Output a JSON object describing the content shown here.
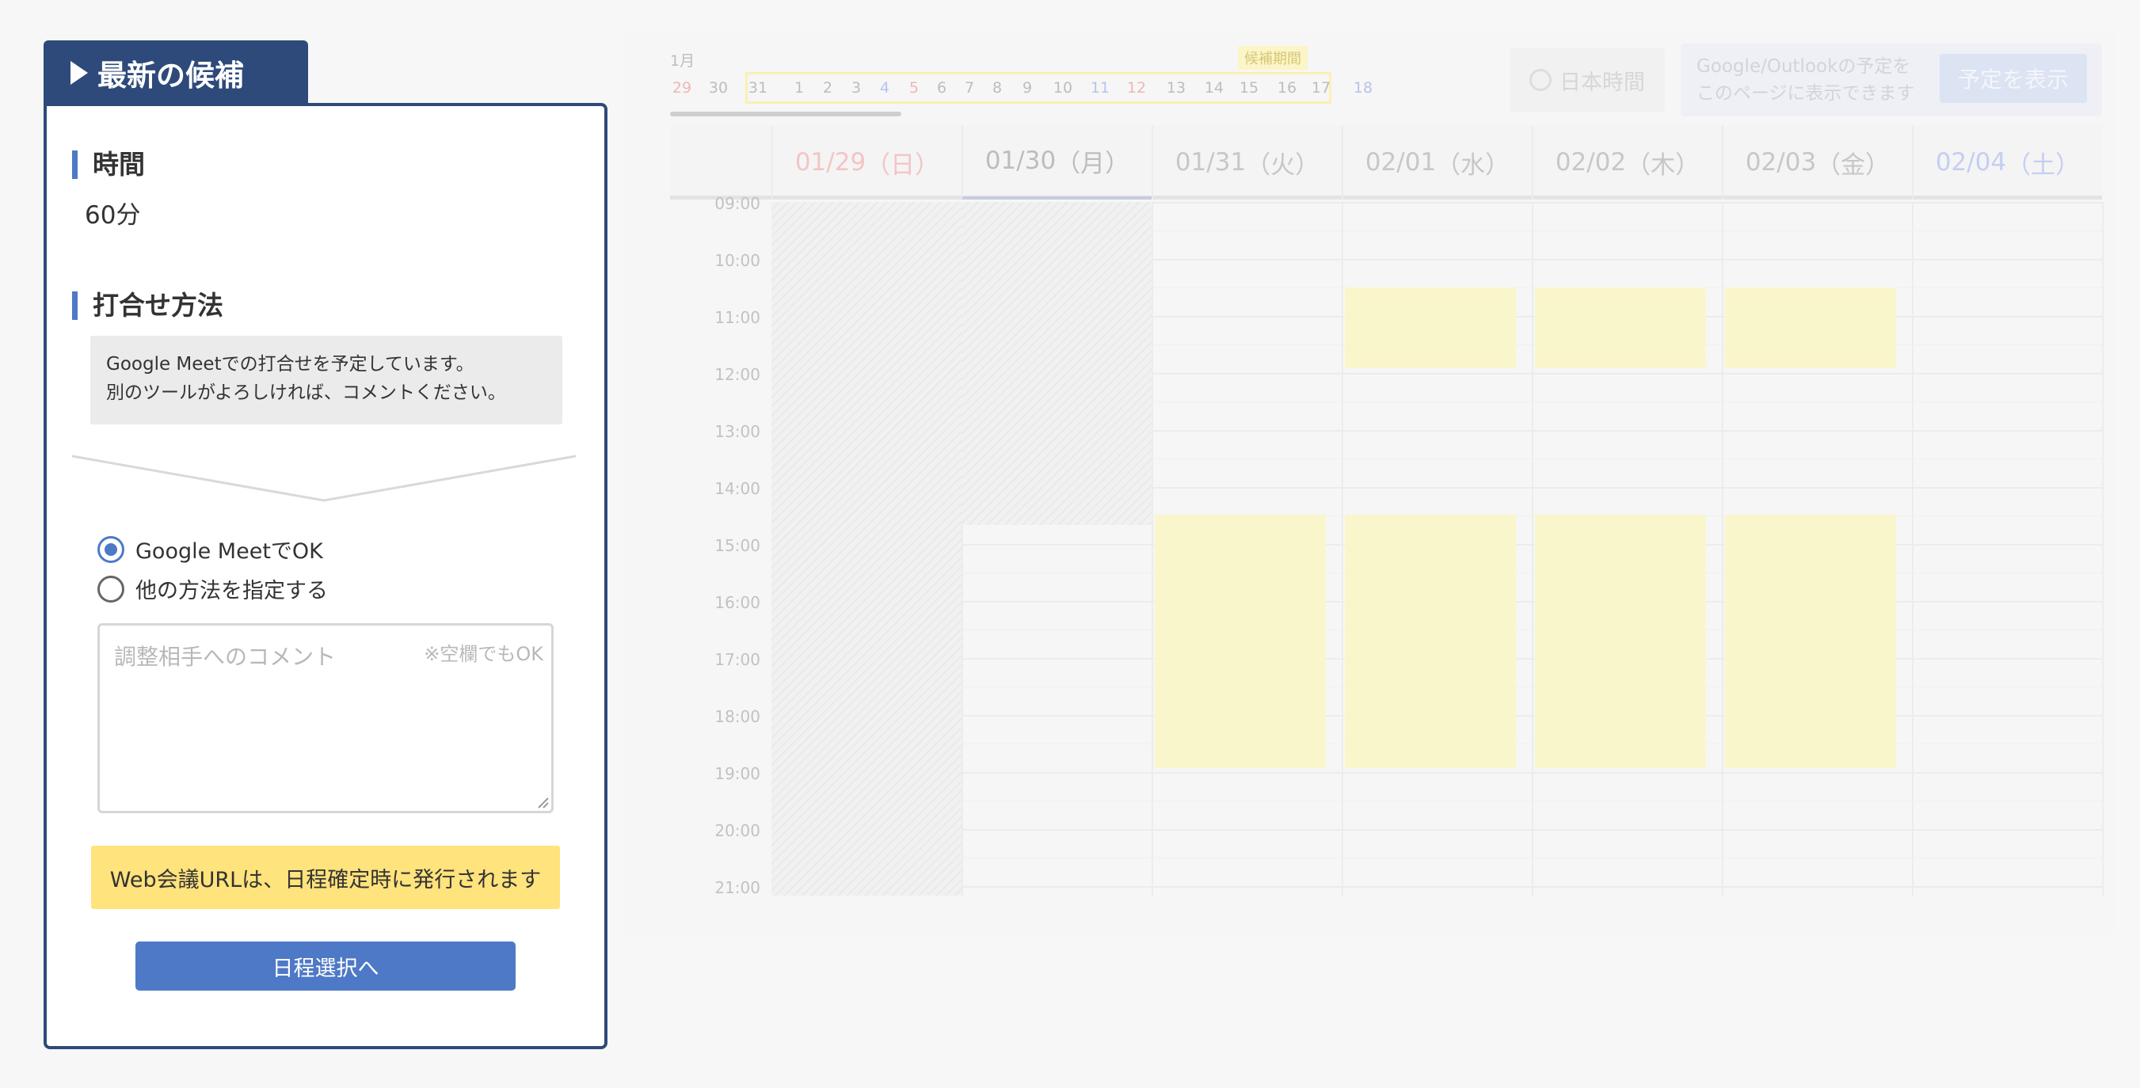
{
  "panel": {
    "tab_title": "最新の候補",
    "time_heading": "時間",
    "duration": "60分",
    "method_heading": "打合せ方法",
    "method_line1": "Google Meetでの打合せを予定しています。",
    "method_line2": "別のツールがよろしければ、コメントください。",
    "radio_ok_label": "Google MeetでOK",
    "radio_other_label": "他の方法を指定する",
    "selected_option": "Google MeetでOK",
    "comment_placeholder": "調整相手へのコメント",
    "comment_optional_note": "※空欄でもOK",
    "notice": "Web会議URLは、日程確定時に発行されます",
    "next_button": "日程選択へ"
  },
  "calendar": {
    "month_label": "1月",
    "days": [
      "29",
      "30",
      "31",
      "1",
      "2",
      "3",
      "4",
      "5",
      "6",
      "7",
      "8",
      "9",
      "10",
      "11",
      "12",
      "13",
      "14",
      "15",
      "16",
      "17",
      "18"
    ],
    "candidate_period_label": "候補期間",
    "timezone_button": "日本時間",
    "external_text_line1": "Google/Outlookの予定を",
    "external_text_line2": "このページに表示できます",
    "show_events_button": "予定を表示",
    "columns": [
      {
        "date": "01/29",
        "weekday": "（日）"
      },
      {
        "date": "01/30",
        "weekday": "（月）"
      },
      {
        "date": "01/31",
        "weekday": "（火）"
      },
      {
        "date": "02/01",
        "weekday": "（水）"
      },
      {
        "date": "02/02",
        "weekday": "（木）"
      },
      {
        "date": "02/03",
        "weekday": "（金）"
      },
      {
        "date": "02/04",
        "weekday": "（土）"
      }
    ],
    "hours": [
      "09:00",
      "10:00",
      "11:00",
      "12:00",
      "13:00",
      "14:00",
      "15:00",
      "16:00",
      "17:00",
      "18:00",
      "19:00",
      "20:00",
      "21:00"
    ],
    "colors": {
      "accent": "#4e79c6",
      "navy": "#2d4a7a",
      "notice": "#ffe37c",
      "candidate_slot": "#faf6cc"
    }
  }
}
